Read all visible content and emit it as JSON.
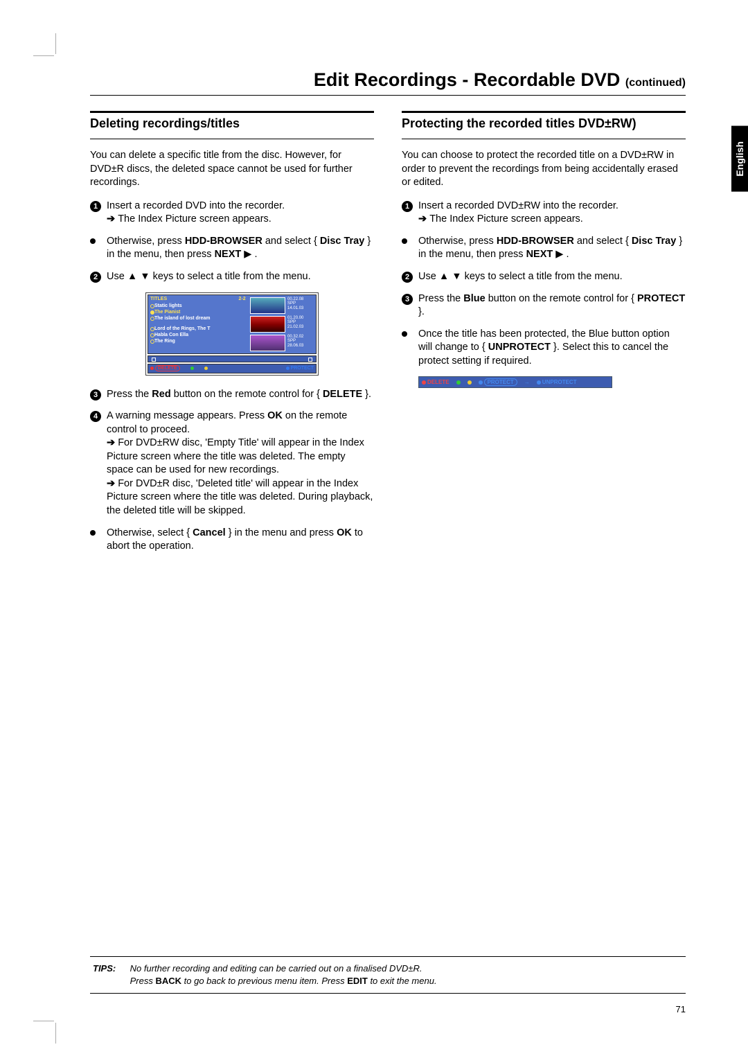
{
  "lang_tab": "English",
  "page_title_main": "Edit Recordings - Recordable DVD ",
  "page_title_cont": "(continued)",
  "page_number": "71",
  "left": {
    "heading": "Deleting recordings/titles",
    "intro": "You can delete a specific title from the disc. However, for DVD±R discs, the deleted space cannot be used for further recordings.",
    "s1a": "Insert a recorded DVD into the recorder.",
    "s1b": "The Index Picture screen appears.",
    "alt1_a": "Otherwise, press ",
    "alt1_b": "HDD-BROWSER",
    "alt1_c": " and select { ",
    "alt1_d": "Disc Tray",
    "alt1_e": " } in the menu, then press ",
    "alt1_f": "NEXT",
    "alt1_g": " ▶ .",
    "s2": "Use ▲ ▼ keys to select a title from the menu.",
    "s3_a": "Press the ",
    "s3_b": "Red",
    "s3_c": " button on the remote control for { ",
    "s3_d": "DELETE",
    "s3_e": " }.",
    "s4_a": "A warning message appears. Press ",
    "s4_b": "OK",
    "s4_c": " on the remote control to proceed.",
    "s4_d": "For DVD±RW disc, 'Empty Title' will appear in the Index Picture screen where the title was deleted. The empty space can be used for new recordings.",
    "s4_e": "For DVD±R disc, 'Deleted title' will appear in the Index Picture screen where the title was deleted. During playback, the deleted title will be skipped.",
    "alt2_a": "Otherwise, select { ",
    "alt2_b": "Cancel",
    "alt2_c": " } in the menu and press ",
    "alt2_d": "OK",
    "alt2_e": " to abort the operation."
  },
  "right": {
    "heading": "Protecting the recorded titles DVD±RW)",
    "intro": "You can choose to protect the recorded title on a DVD±RW in order to prevent the recordings from being accidentally erased or edited.",
    "s1a": "Insert a recorded DVD±RW into the recorder.",
    "s1b": "The Index Picture screen appears.",
    "alt1_a": "Otherwise, press ",
    "alt1_b": "HDD-BROWSER",
    "alt1_c": " and select { ",
    "alt1_d": "Disc Tray",
    "alt1_e": " } in the menu, then press ",
    "alt1_f": "NEXT",
    "alt1_g": " ▶ .",
    "s2": "Use ▲ ▼ keys to select a title from the menu.",
    "s3_a": "Press the ",
    "s3_b": "Blue",
    "s3_c": " button on the remote control for { ",
    "s3_d": "PROTECT",
    "s3_e": " }.",
    "s4_a": "Once the title has been protected, the Blue button option will change to { ",
    "s4_b": "UNPROTECT",
    "s4_c": " }. Select this to cancel the protect setting if required."
  },
  "screen": {
    "hdr": "TITLES",
    "hdr_num": "2-2",
    "items": [
      "Static lights",
      "The Pianist",
      "The island of lost dream",
      "Lord of the Rings, The T",
      "Habla Con Ella",
      "The Ring"
    ],
    "thumbs": [
      {
        "t": "00.22.08",
        "spp": "SPP",
        "d": "14.01.03"
      },
      {
        "t": "01.20.00",
        "spp": "SPP",
        "d": "21.02.03"
      },
      {
        "t": "00.32.02",
        "spp": "SPP",
        "d": "28.06.03"
      }
    ],
    "btn_delete": "DELETE",
    "btn_protect": "PROTECT",
    "btn_unprotect": "UNPROTECT"
  },
  "tips": {
    "label": "TIPS:",
    "line1": "No further recording and editing can be carried out on a finalised DVD±R.",
    "line2_a": "Press ",
    "line2_b": "BACK",
    "line2_c": " to go back to previous menu item. Press ",
    "line2_d": "EDIT",
    "line2_e": " to exit the menu."
  }
}
